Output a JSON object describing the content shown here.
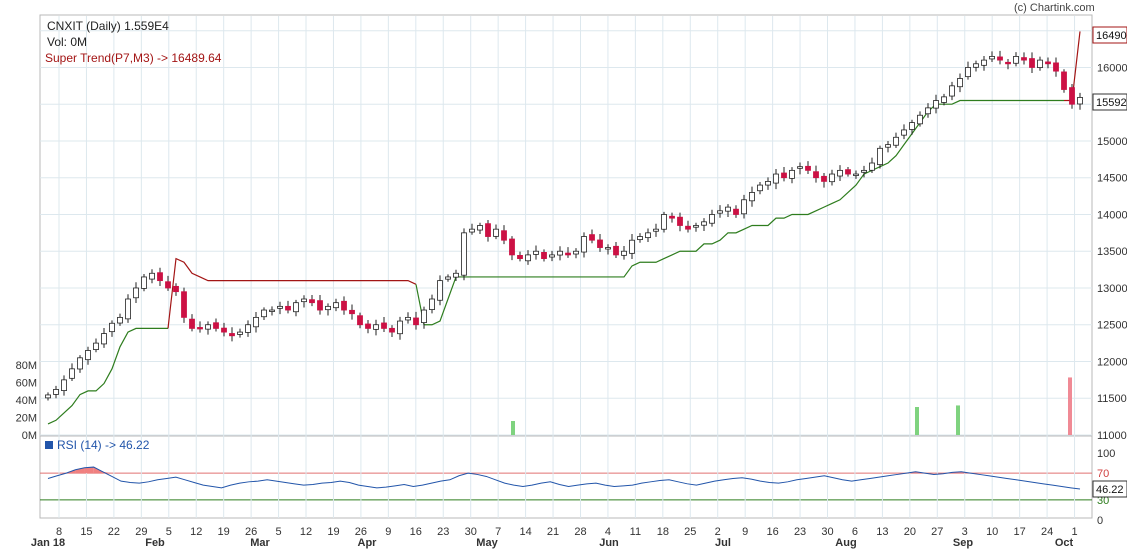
{
  "header": {
    "title": "CNXIT (Daily) 1.559E4",
    "volume_label": "Vol: 0M",
    "supertrend_label": "Super Trend(P7,M3) -> 16489.64",
    "copyright": "(c) Chartink.com"
  },
  "price_axis": {
    "ticks": [
      "16500",
      "16000",
      "15500",
      "15000",
      "14500",
      "14000",
      "13500",
      "13000",
      "12500",
      "12000",
      "11500",
      "11000"
    ],
    "last_price_badge": "15592",
    "supertrend_badge": "16490"
  },
  "volume_axis": {
    "ticks": [
      "80M",
      "60M",
      "40M",
      "20M",
      "0M"
    ]
  },
  "rsi_panel": {
    "label": "RSI (14) -> 46.22",
    "ticks": [
      "100",
      "70",
      "30",
      "0"
    ],
    "value_badge": "46.22",
    "upper_level": 70,
    "lower_level": 30
  },
  "x_axis": {
    "ticks": [
      "8",
      "15",
      "22",
      "29",
      "5",
      "12",
      "19",
      "26",
      "5",
      "12",
      "19",
      "26",
      "9",
      "16",
      "23",
      "30",
      "7",
      "14",
      "21",
      "28",
      "4",
      "11",
      "18",
      "25",
      "2",
      "9",
      "16",
      "23",
      "30",
      "6",
      "13",
      "20",
      "27",
      "3",
      "10",
      "17",
      "24",
      "1"
    ],
    "months": [
      "Jan 18",
      "Feb",
      "Mar",
      "Apr",
      "May",
      "Jun",
      "Jul",
      "Aug",
      "Sep",
      "Oct"
    ]
  },
  "colors": {
    "up_candle": "#ffffff",
    "down_candle": "#cc1144",
    "supertrend_up": "#2e7d1e",
    "supertrend_down": "#a31515",
    "rsi_line": "#2255aa",
    "rsi_fill": "#f08080",
    "grid": "#dde8ee",
    "volume_up": "#7fd37f",
    "volume_down": "#f08a95"
  },
  "chart_data": {
    "type": "candlestick",
    "title": "CNXIT (Daily) 1.559E4",
    "ylim": [
      11000,
      16700
    ],
    "rsi_ylim": [
      0,
      100
    ],
    "volume_ylim": [
      0,
      90
    ],
    "x_dates": [
      "Jan 18",
      "",
      "",
      "",
      "",
      "",
      "",
      "",
      "",
      "",
      "",
      "",
      "",
      "",
      "",
      "",
      "Feb",
      "",
      "",
      "",
      "",
      "",
      "",
      "",
      "",
      "",
      "",
      "",
      "",
      "",
      "",
      "",
      "",
      "",
      "",
      "",
      "",
      "Mar",
      "",
      "",
      "",
      "",
      "",
      "",
      "",
      "",
      "",
      "",
      "",
      "",
      "",
      "",
      "",
      "",
      "",
      "",
      "",
      "",
      "",
      "Apr",
      "",
      "",
      "",
      "",
      "",
      "",
      "",
      "",
      "",
      "",
      "",
      "",
      "",
      "",
      "",
      "",
      "",
      "",
      "May",
      "",
      "",
      "",
      "",
      "",
      "",
      "",
      "",
      "",
      "",
      "",
      "",
      "",
      "",
      "",
      "",
      "",
      "",
      "",
      "",
      "Jun",
      "",
      "",
      "",
      "",
      "",
      "",
      "",
      "",
      "",
      "",
      "",
      "",
      "",
      "",
      "",
      "",
      "",
      "",
      "",
      "",
      "Jul",
      "",
      "",
      "",
      "",
      "",
      "",
      "",
      "",
      "",
      "",
      "",
      "",
      "",
      "",
      "",
      "",
      "",
      "",
      "",
      "",
      "",
      "Aug",
      "",
      "",
      "",
      "",
      "",
      "",
      "",
      "",
      "",
      "",
      "",
      "",
      "",
      "",
      "",
      "",
      "",
      "",
      "",
      "",
      "Sep",
      "",
      "",
      "",
      "",
      "",
      "",
      "",
      "",
      "",
      "",
      "",
      "",
      "",
      "",
      "",
      "",
      "",
      "",
      "",
      "",
      "Oct",
      "",
      "",
      ""
    ],
    "close_series": [
      11545,
      11620,
      11750,
      11900,
      12050,
      12150,
      12250,
      12380,
      12520,
      12600,
      12850,
      13000,
      13150,
      13200,
      13100,
      13000,
      12950,
      12600,
      12450,
      12450,
      12500,
      12450,
      12400,
      12350,
      12400,
      12500,
      12600,
      12700,
      12700,
      12750,
      12700,
      12800,
      12850,
      12800,
      12700,
      12750,
      12800,
      12700,
      12650,
      12500,
      12450,
      12500,
      12450,
      12400,
      12550,
      12600,
      12500,
      12700,
      12850,
      13100,
      13150,
      13200,
      13750,
      13800,
      13850,
      13700,
      13800,
      13650,
      13450,
      13400,
      13450,
      13500,
      13400,
      13450,
      13500,
      13450,
      13500,
      13700,
      13650,
      13550,
      13550,
      13450,
      13500,
      13650,
      13700,
      13750,
      13800,
      14000,
      13950,
      13850,
      13800,
      13850,
      13900,
      14000,
      14050,
      14100,
      14000,
      14200,
      14300,
      14400,
      14450,
      14550,
      14500,
      14600,
      14650,
      14600,
      14500,
      14450,
      14550,
      14600,
      14550,
      14550,
      14600,
      14700,
      14900,
      14950,
      15050,
      15150,
      15250,
      15350,
      15450,
      15550,
      15600,
      15750,
      15850,
      16000,
      16050,
      16100,
      16150,
      16100,
      16050,
      16150,
      16100,
      16000,
      16100,
      16050,
      15950,
      15700,
      15500,
      15592
    ],
    "supertrend_series": [
      11150,
      11200,
      11300,
      11400,
      11550,
      11600,
      11600,
      11700,
      11900,
      12200,
      12400,
      12450,
      12450,
      12450,
      12450,
      12450,
      13400,
      13350,
      13200,
      13150,
      13100,
      13100,
      13100,
      13100,
      13100,
      13100,
      13100,
      13100,
      13100,
      13100,
      13100,
      13100,
      13100,
      13100,
      13100,
      13100,
      13100,
      13100,
      13100,
      13100,
      13100,
      13100,
      13100,
      13100,
      13100,
      13100,
      13050,
      12500,
      12500,
      12550,
      12850,
      13150,
      13150,
      13150,
      13150,
      13150,
      13150,
      13150,
      13150,
      13150,
      13150,
      13150,
      13150,
      13150,
      13150,
      13150,
      13150,
      13150,
      13150,
      13150,
      13150,
      13150,
      13150,
      13300,
      13350,
      13350,
      13350,
      13400,
      13450,
      13500,
      13500,
      13500,
      13600,
      13600,
      13650,
      13750,
      13750,
      13800,
      13850,
      13850,
      13850,
      13950,
      13950,
      14000,
      14000,
      14000,
      14050,
      14100,
      14150,
      14200,
      14300,
      14400,
      14550,
      14600,
      14650,
      14700,
      14800,
      14950,
      15100,
      15250,
      15400,
      15500,
      15500,
      15500,
      15550,
      15550,
      15550,
      15550,
      15550,
      15550,
      15550,
      15550,
      15550,
      15550,
      15550,
      15550,
      15550,
      15550,
      15550,
      16489.64
    ],
    "rsi_series": [
      62,
      66,
      70,
      75,
      78,
      79,
      72,
      65,
      58,
      56,
      55,
      57,
      60,
      62,
      64,
      60,
      56,
      52,
      50,
      48,
      52,
      55,
      57,
      58,
      60,
      58,
      56,
      54,
      52,
      53,
      55,
      56,
      58,
      56,
      52,
      50,
      48,
      49,
      51,
      53,
      50,
      52,
      55,
      58,
      60,
      66,
      70,
      68,
      65,
      60,
      55,
      52,
      50,
      52,
      55,
      57,
      53,
      50,
      52,
      54,
      55,
      52,
      50,
      51,
      52,
      55,
      57,
      59,
      60,
      57,
      54,
      52,
      55,
      58,
      60,
      62,
      63,
      61,
      58,
      56,
      55,
      57,
      60,
      62,
      64,
      66,
      63,
      60,
      58,
      60,
      62,
      64,
      66,
      68,
      70,
      72,
      70,
      68,
      69,
      71,
      72,
      70,
      68,
      66,
      64,
      62,
      60,
      58,
      56,
      54,
      52,
      50,
      48,
      46.22
    ],
    "volume_spikes": [
      {
        "date": "May 8",
        "value": 18,
        "color": "up"
      },
      {
        "date": "Aug 21",
        "value": 36,
        "color": "up"
      },
      {
        "date": "Aug 29",
        "value": 38,
        "color": "up"
      },
      {
        "date": "Oct 1",
        "value": 74,
        "color": "down"
      }
    ]
  }
}
